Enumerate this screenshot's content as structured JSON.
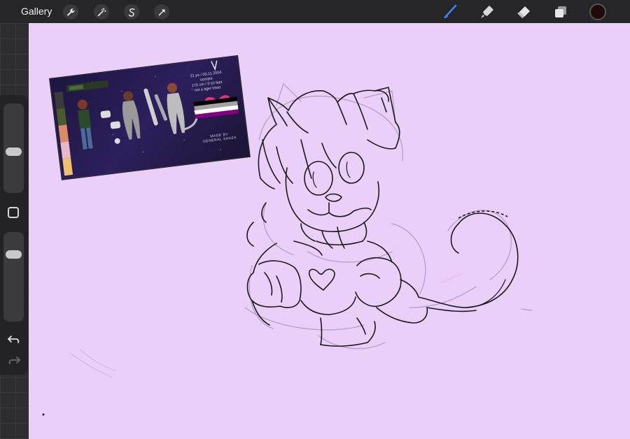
{
  "toolbar": {
    "gallery_label": "Gallery",
    "left_tools": [
      "wrench-icon",
      "magic-wand-icon",
      "selection-icon",
      "transform-icon"
    ],
    "right_tools": [
      "brush-icon",
      "smudge-icon",
      "eraser-icon",
      "layers-icon"
    ],
    "active_tool": "brush-icon",
    "accent": "#3b82f6",
    "current_color": "#1e0a0a"
  },
  "canvas": {
    "background": "#ead0f8"
  },
  "sidebar": {
    "brush_size": 0.45,
    "opacity": 0.8,
    "undo_icon": "undo-icon",
    "redo_icon": "redo-icon"
  },
  "reference": {
    "info_line1": "21 yo / 03.11.2004",
    "info_line2": "scorpio",
    "info_line3": "175 cm / 5'10 feet",
    "info_line4": "not a tiger lmao",
    "heart_colors": [
      "#e4328a",
      "#f8d800",
      "#1ab3ff"
    ],
    "flag_colors": [
      "#000000",
      "#a3a3a3",
      "#ffffff",
      "#800080"
    ],
    "made_by_line1": "MADE BY",
    "made_by_line2": "GENERAL SHAZA",
    "palette_colors": [
      "#3a3a3a",
      "#4a5a2a",
      "#d98a6a",
      "#e8b8c8",
      "#f0c070"
    ]
  }
}
